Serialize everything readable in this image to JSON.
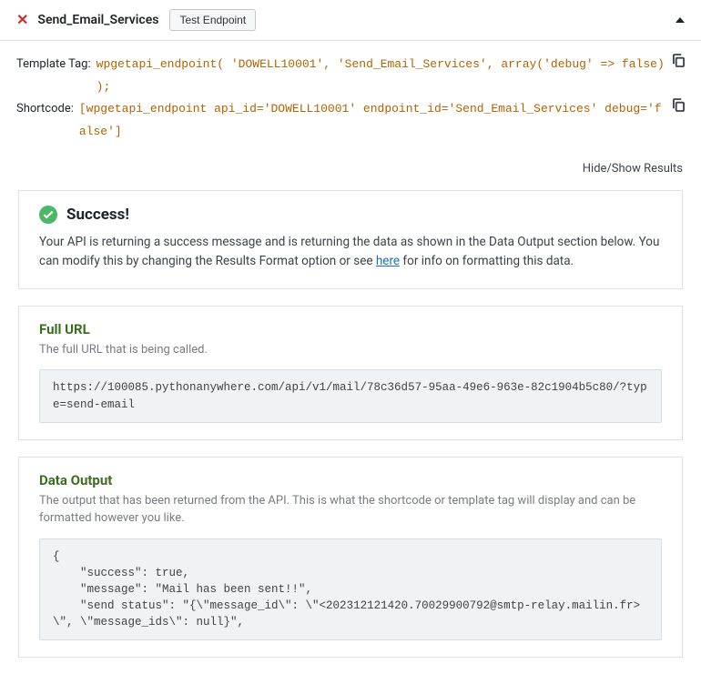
{
  "header": {
    "title": "Send_Email_Services",
    "test_button": "Test Endpoint"
  },
  "meta": {
    "template_label": "Template Tag:",
    "template_code": "wpgetapi_endpoint( 'DOWELL10001', 'Send_Email_Services', array('debug' => false) );",
    "shortcode_label": "Shortcode:",
    "shortcode_code": "[wpgetapi_endpoint api_id='DOWELL10001' endpoint_id='Send_Email_Services' debug='false']"
  },
  "toggle": "Hide/Show Results",
  "success": {
    "title": "Success!",
    "desc_before": "Your API is returning a success message and is returning the data as shown in the Data Output section below. You can modify this by changing the Results Format option or see ",
    "desc_link": "here",
    "desc_after": " for info on formatting this data."
  },
  "full_url": {
    "heading": "Full URL",
    "sub": "The full URL that is being called.",
    "value": "https://100085.pythonanywhere.com/api/v1/mail/78c36d57-95aa-49e6-963e-82c1904b5c80/?type=send-email"
  },
  "data_output": {
    "heading": "Data Output",
    "sub": "The output that has been returned from the API. This is what the shortcode or template tag will display and can be formatted however you like.",
    "value": "{\n    \"success\": true,\n    \"message\": \"Mail has been sent!!\",\n    \"send status\": \"{\\\"message_id\\\": \\\"<202312121420.70029900792@smtp-relay.mailin.fr>\\\", \\\"message_ids\\\": null}\","
  }
}
